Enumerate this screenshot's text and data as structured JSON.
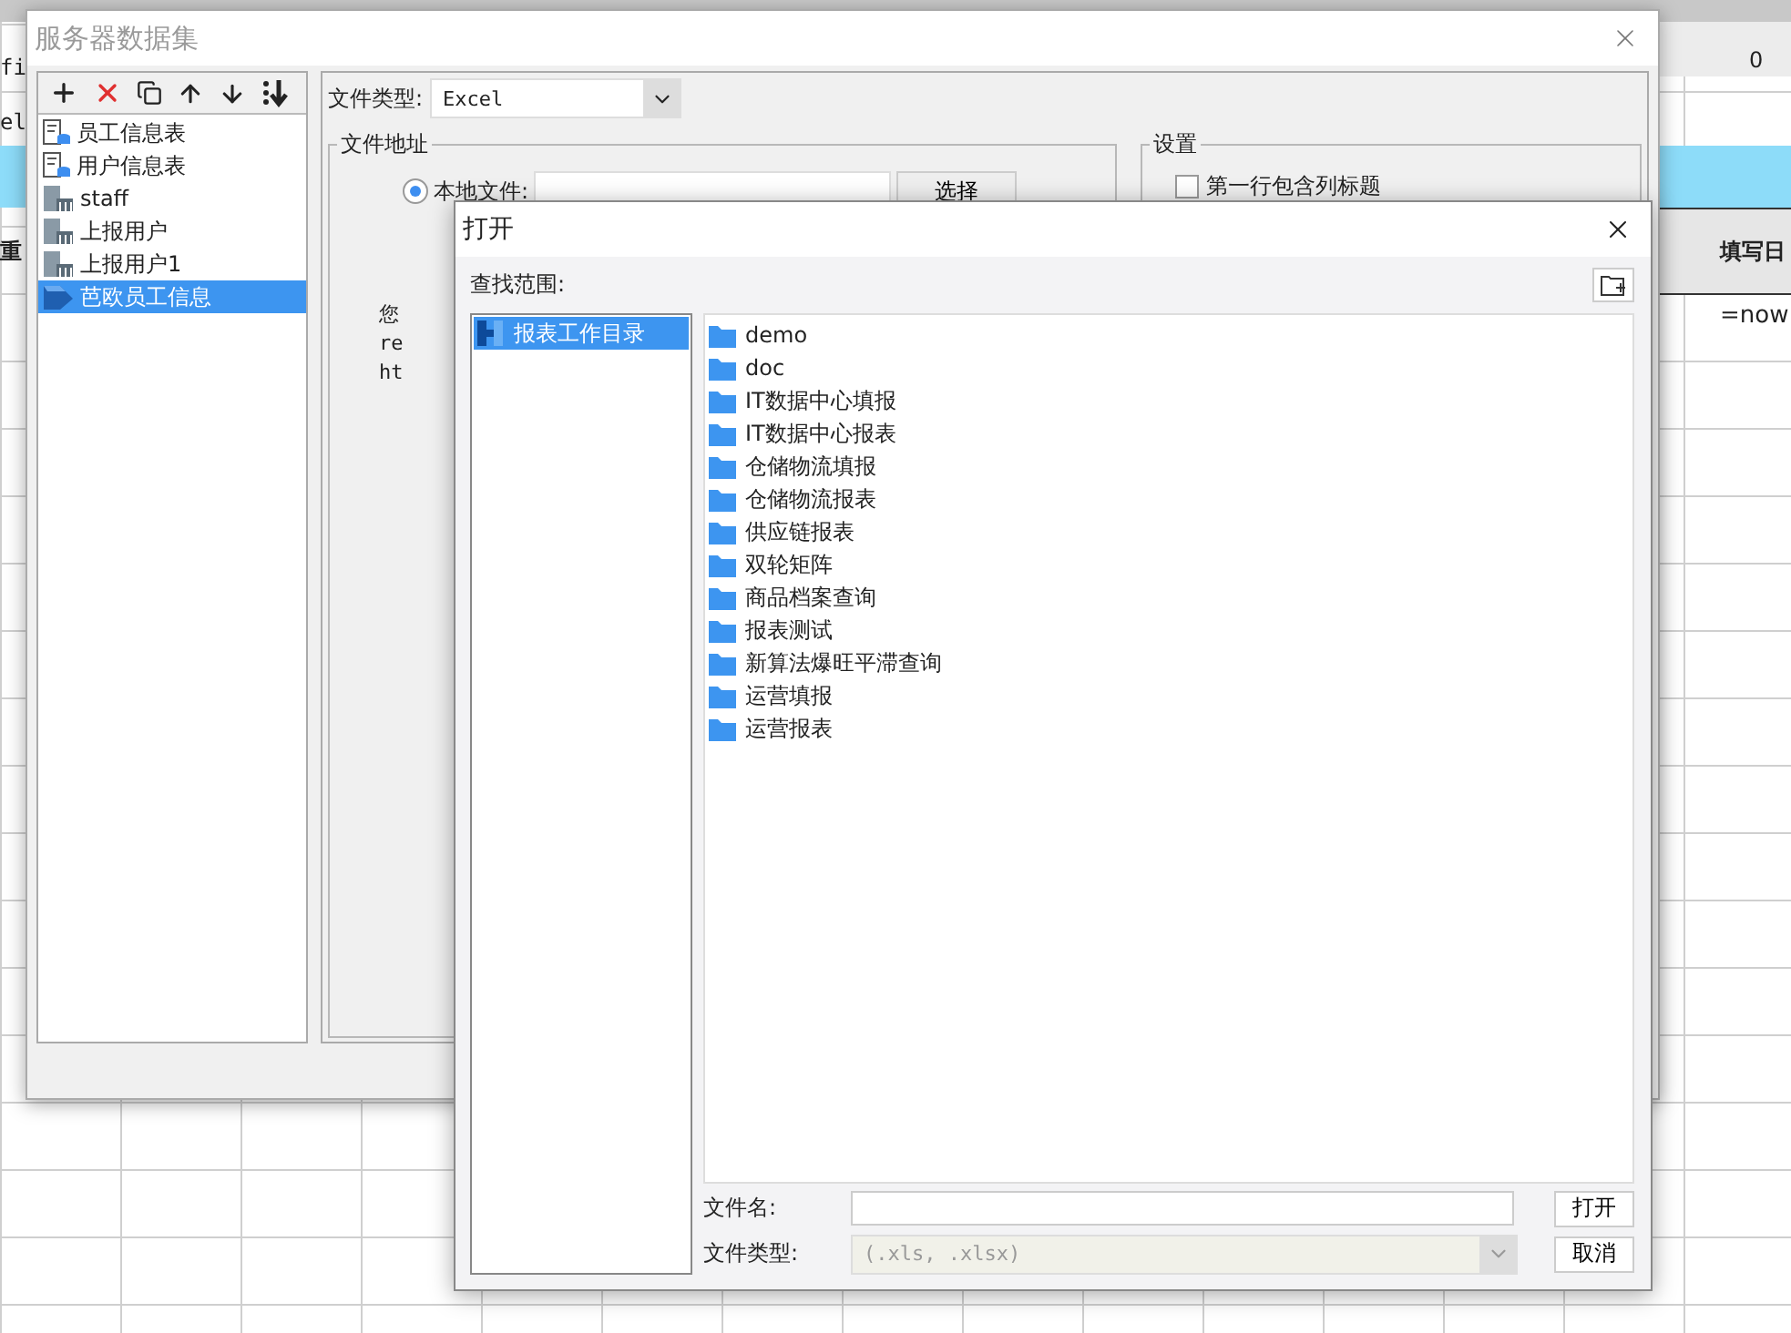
{
  "sheet": {
    "cells": [
      {
        "text": "fi",
        "kind": "plain"
      },
      {
        "text": "el",
        "kind": "plain"
      },
      {
        "text": "重",
        "kind": "header"
      },
      {
        "text": "0",
        "kind": "column"
      },
      {
        "text": "填写日",
        "kind": "header"
      },
      {
        "text": "=now",
        "kind": "formula"
      }
    ]
  },
  "dataset_window": {
    "title": "服务器数据集",
    "datasets": [
      {
        "label": "员工信息表",
        "kind": "table",
        "selected": false
      },
      {
        "label": "用户信息表",
        "kind": "table",
        "selected": false
      },
      {
        "label": "staff",
        "kind": "server",
        "selected": false
      },
      {
        "label": "上报用户",
        "kind": "server",
        "selected": false
      },
      {
        "label": "上报用户1",
        "kind": "server",
        "selected": false
      },
      {
        "label": "芭欧员工信息",
        "kind": "file",
        "selected": true
      }
    ],
    "file_type_label": "文件类型:",
    "file_type": "Excel",
    "address_group": "文件地址",
    "local_file": {
      "label": "本地文件:",
      "selected": true
    },
    "choose_button": "选择",
    "fragments": [
      "您",
      "re",
      "ht"
    ],
    "settings_group": "设置",
    "header_checkbox": {
      "label": "第一行包含列标题",
      "checked": false
    }
  },
  "open_dialog": {
    "title": "打开",
    "look_in_label": "查找范围:",
    "locations": [
      {
        "label": "报表工作目录",
        "selected": true
      }
    ],
    "files": [
      "demo",
      "doc",
      "IT数据中心填报",
      "IT数据中心报表",
      "仓储物流填报",
      "仓储物流报表",
      "供应链报表",
      "双轮矩阵",
      "商品档案查询",
      "报表测试",
      "新算法爆旺平滞查询",
      "运营填报",
      "运营报表"
    ],
    "file_name_label": "文件名:",
    "file_type_label": "文件类型:",
    "file_type": "(.xls, .xlsx)",
    "file_type_disabled": true,
    "open_button": "打开",
    "cancel_button": "取消"
  }
}
